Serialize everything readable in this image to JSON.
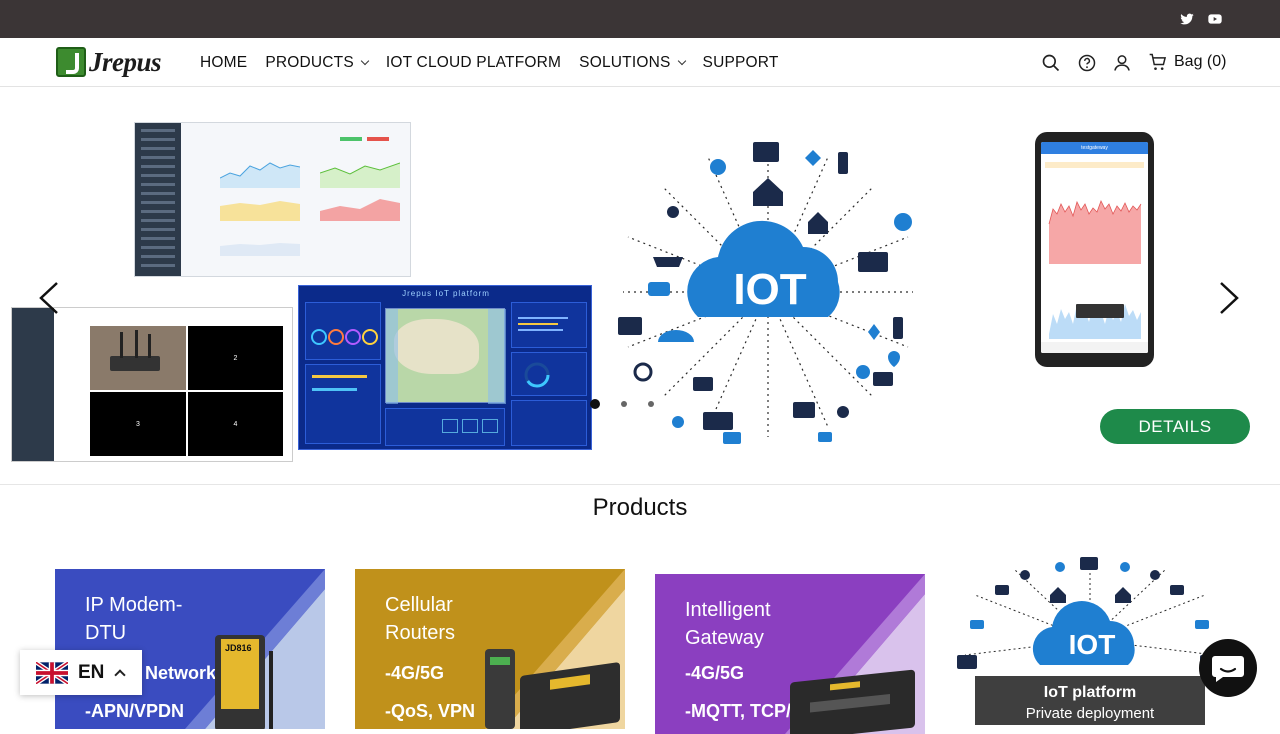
{
  "topbar": {
    "social": [
      {
        "icon": "twitter-icon"
      },
      {
        "icon": "youtube-icon"
      }
    ]
  },
  "header": {
    "logo_text": "Jrepus",
    "nav": [
      {
        "label": "HOME",
        "has_dropdown": false
      },
      {
        "label": "PRODUCTS",
        "has_dropdown": true
      },
      {
        "label": "IOT CLOUD PLATFORM",
        "has_dropdown": false
      },
      {
        "label": "SOLUTIONS",
        "has_dropdown": true
      },
      {
        "label": "SUPPORT",
        "has_dropdown": false
      }
    ],
    "icons": [
      "search-icon",
      "help-icon",
      "account-icon",
      "bag-icon"
    ],
    "bag_label": "Bag (0)"
  },
  "hero": {
    "platform_title": "Jrepus IoT platform",
    "iot_label": "IOT",
    "phone_title": "testgateway",
    "details_label": "DETAILS",
    "grid_labels": [
      "2",
      "3",
      "4"
    ],
    "slides": 3,
    "active_slide": 1
  },
  "products": {
    "title": "Products",
    "cards": [
      {
        "title_line1": "IP Modem-",
        "title_line2": "DTU",
        "feature1": "Network",
        "feature2": "-APN/VPDN",
        "device_label": "JD816",
        "color": "#3a4cc0"
      },
      {
        "title_line1": "Cellular",
        "title_line2": "Routers",
        "feature1": "-4G/5G",
        "feature2": "-QoS, VPN",
        "color": "#c0911b"
      },
      {
        "title_line1": "Intelligent",
        "title_line2": "Gateway",
        "feature1": "-4G/5G",
        "feature2": "-MQTT, TCP/IP",
        "color": "#8b3fc0"
      },
      {
        "label_line1": "IoT platform",
        "label_line2": "Private deployment",
        "iot_label": "IOT"
      }
    ]
  },
  "language": {
    "code": "EN"
  },
  "colors": {
    "topbar": "#3b3536",
    "details": "#1e8a4a",
    "iot_blue": "#1f7fd1"
  }
}
